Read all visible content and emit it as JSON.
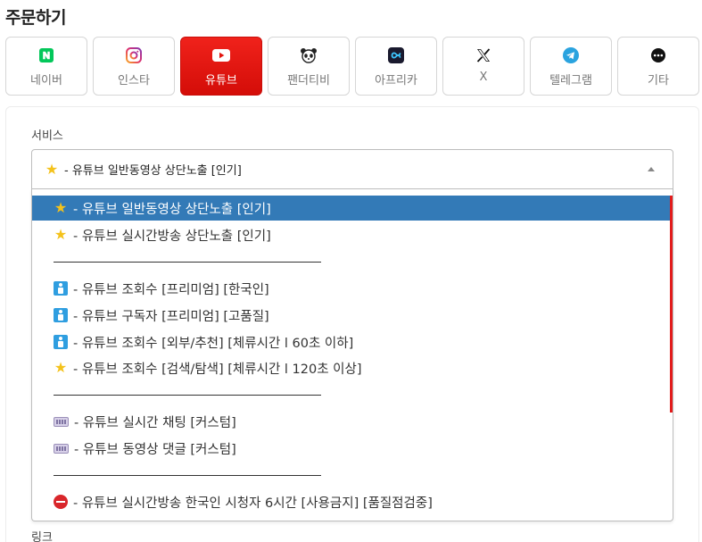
{
  "page": {
    "title": "주문하기"
  },
  "platforms": [
    {
      "label": "네이버",
      "icon": "naver-icon"
    },
    {
      "label": "인스타",
      "icon": "instagram-icon"
    },
    {
      "label": "유튜브",
      "icon": "youtube-icon",
      "active": true
    },
    {
      "label": "팬더티비",
      "icon": "pandatv-icon"
    },
    {
      "label": "아프리카",
      "icon": "afreeca-icon"
    },
    {
      "label": "X",
      "icon": "x-icon"
    },
    {
      "label": "텔레그램",
      "icon": "telegram-icon"
    },
    {
      "label": "기타",
      "icon": "more-icon"
    }
  ],
  "service": {
    "label": "서비스",
    "selected_text": "- 유튜브 일반동영상 상단노출 [인기]",
    "selected_icon": "star-icon",
    "options": [
      {
        "icon": "star-icon",
        "text": "- 유튜브 일반동영상 상단노출 [인기]",
        "selected": true
      },
      {
        "icon": "star-icon",
        "text": "- 유튜브 실시간방송 상단노출 [인기]"
      },
      {
        "separator": true
      },
      {
        "icon": "person-icon",
        "text": "- 유튜브 조회수 [프리미엄] [한국인]"
      },
      {
        "icon": "person-icon",
        "text": "- 유튜브 구독자 [프리미엄] [고품질]"
      },
      {
        "icon": "person-icon",
        "text": "- 유튜브 조회수 [외부/추천] [체류시간 l 60초 이하]"
      },
      {
        "icon": "star-icon",
        "text": "- 유튜브 조회수 [검색/탐색] [체류시간 l 120초 이상]"
      },
      {
        "separator": true
      },
      {
        "icon": "keyboard-icon",
        "text": "- 유튜브 실시간 채팅 [커스텀]"
      },
      {
        "icon": "keyboard-icon",
        "text": "- 유튜브 동영상 댓글 [커스텀]"
      },
      {
        "separator": true
      },
      {
        "icon": "no-entry-icon",
        "text": "- 유튜브 실시간방송 한국인 시청자 6시간 [사용금지] [품질점검중]"
      }
    ]
  },
  "link": {
    "label": "링크"
  },
  "colors": {
    "accent": "#e3140e",
    "selected_option": "#337ab7",
    "scrollbar": "#e21b1b"
  }
}
